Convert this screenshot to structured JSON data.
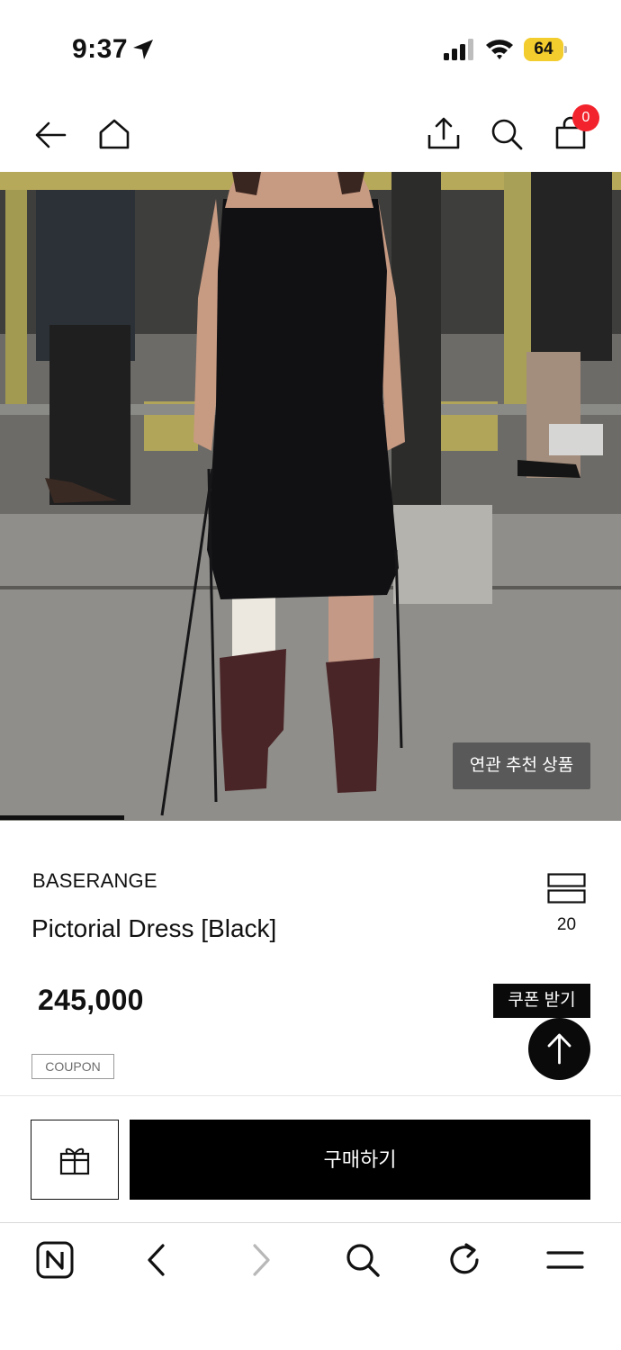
{
  "status_bar": {
    "time": "9:37",
    "battery_level": "64",
    "battery_color": "#f3cc2d"
  },
  "nav": {
    "icons": [
      "back-arrow-icon",
      "home-icon",
      "share-icon",
      "search-icon",
      "cart-icon"
    ],
    "cart_count": "0",
    "badge_color": "#f2232c"
  },
  "hero": {
    "related_button": "연관 추천 상품",
    "image_progress": 0.2
  },
  "product": {
    "brand": "BASERANGE",
    "name": "Pictorial Dress [Black]",
    "like_count": "20",
    "price": "245,000",
    "coupon_button": "쿠폰 받기",
    "coupon_badge": "COUPON"
  },
  "purchase_bar": {
    "gift_icon": "gift-icon",
    "buy_button": "구매하기"
  },
  "browser_toolbar": {
    "icons": [
      "naver-n-icon",
      "browser-back-icon",
      "browser-forward-icon",
      "browser-search-icon",
      "reload-icon",
      "menu-icon"
    ]
  },
  "colors": {
    "primary": "#000000",
    "background": "#ffffff"
  }
}
